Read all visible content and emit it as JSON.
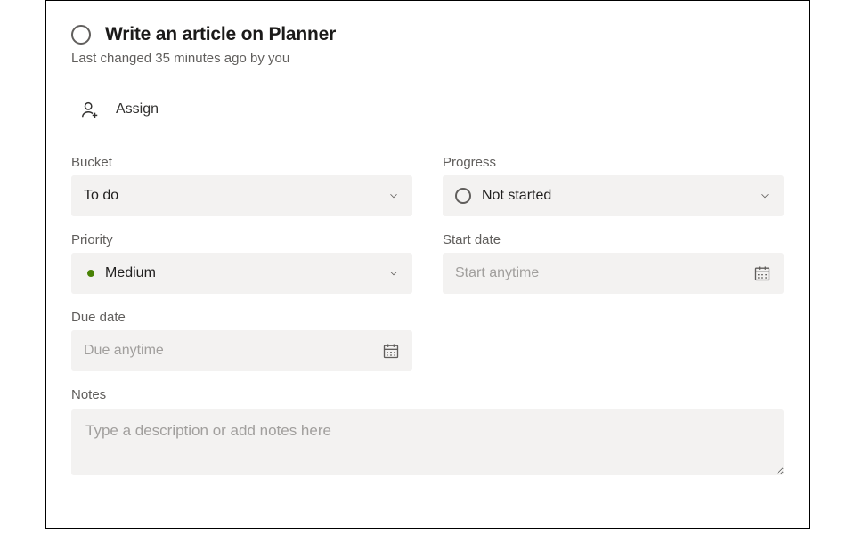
{
  "task": {
    "title": "Write an article on Planner",
    "subtitle": "Last changed 35 minutes ago by you"
  },
  "assign": {
    "label": "Assign"
  },
  "fields": {
    "bucket": {
      "label": "Bucket",
      "value": "To do"
    },
    "progress": {
      "label": "Progress",
      "value": "Not started"
    },
    "priority": {
      "label": "Priority",
      "value": "Medium"
    },
    "start_date": {
      "label": "Start date",
      "placeholder": "Start anytime"
    },
    "due_date": {
      "label": "Due date",
      "placeholder": "Due anytime"
    }
  },
  "notes": {
    "label": "Notes",
    "placeholder": "Type a description or add notes here"
  }
}
